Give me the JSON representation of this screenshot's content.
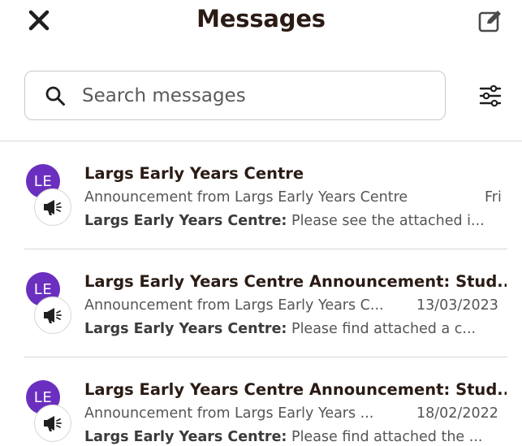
{
  "header": {
    "title": "Messages",
    "close_icon": "close-icon",
    "compose_icon": "compose-icon"
  },
  "search": {
    "placeholder": "Search messages",
    "value": ""
  },
  "messages": [
    {
      "avatar_initials": "LE",
      "title": "Largs Early Years Centre",
      "subtitle": "Announcement from Largs Early Years Centre",
      "date": "Fri",
      "sender": "Largs Early Years Centre:",
      "preview": "Please see the attached i..."
    },
    {
      "avatar_initials": "LE",
      "title": "Largs Early Years Centre Announcement: Stud...",
      "subtitle": "Announcement from Largs Early Years C...",
      "date": "13/03/2023",
      "sender": "Largs Early Years Centre:",
      "preview": "Please find attached a c..."
    },
    {
      "avatar_initials": "LE",
      "title": "Largs Early Years Centre Announcement: Stud...",
      "subtitle": "Announcement from Largs Early Years ...",
      "date": "18/02/2022",
      "sender": "Largs Early Years Centre:",
      "preview": "Please find attached the ..."
    }
  ],
  "colors": {
    "avatar_bg": "#6b2fbf",
    "title_text": "#2a1b14",
    "secondary_text": "#555555"
  }
}
